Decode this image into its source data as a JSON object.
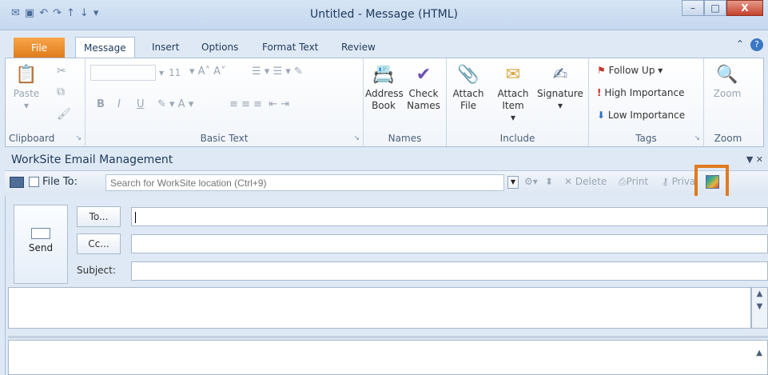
{
  "window": {
    "title": "Untitled - Message (HTML)",
    "qat_icons": [
      "outlook-icon",
      "save-icon",
      "undo-icon",
      "redo-icon",
      "up-icon",
      "down-icon",
      "customize-icon"
    ]
  },
  "tabs": {
    "file": "File",
    "items": [
      "Message",
      "Insert",
      "Options",
      "Format Text",
      "Review"
    ],
    "active": "Message"
  },
  "ribbon": {
    "clipboard": {
      "label": "Clipboard",
      "paste": "Paste"
    },
    "basic_text": {
      "label": "Basic Text",
      "font_size": "11"
    },
    "names": {
      "label": "Names",
      "address_book": "Address Book",
      "check_names": "Check Names"
    },
    "include": {
      "label": "Include",
      "attach_file": "Attach File",
      "attach_item": "Attach Item",
      "signature": "Signature"
    },
    "tags": {
      "label": "Tags",
      "follow_up": "Follow Up",
      "high_importance": "High Importance",
      "low_importance": "Low Importance"
    },
    "zoom": {
      "label": "Zoom",
      "zoom_btn": "Zoom"
    }
  },
  "worksite": {
    "header": "WorkSite Email Management",
    "file_to_label": "File To:",
    "search_placeholder": "Search for WorkSite location (Ctrl+9)",
    "delete": "Delete",
    "print": "Print",
    "private": "Priva",
    "highlight_color": "#e07a1f"
  },
  "compose": {
    "send": "Send",
    "to_btn": "To...",
    "cc_btn": "Cc...",
    "subject_label": "Subject:",
    "to_value": "",
    "cc_value": "",
    "subject_value": ""
  }
}
